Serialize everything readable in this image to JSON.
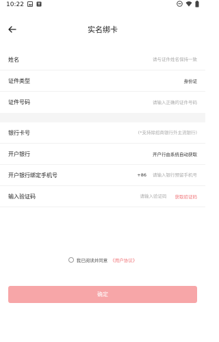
{
  "status_bar": {
    "time": "10:22"
  },
  "header": {
    "title": "实名绑卡"
  },
  "form": {
    "name": {
      "label": "姓名",
      "placeholder": "请与证件姓名保持一致"
    },
    "id_type": {
      "label": "证件类型",
      "value": "身份证"
    },
    "id_number": {
      "label": "证件号码",
      "placeholder": "请输入正确的证件号码"
    },
    "bank_card": {
      "label": "银行卡号",
      "placeholder": "(*支持除招商银行外主流银行)"
    },
    "bank": {
      "label": "开户银行",
      "value": "开户行由系统自动获取"
    },
    "phone": {
      "label": "开户银行绑定手机号",
      "prefix": "+86",
      "placeholder": "请输入银行预留手机号"
    },
    "code": {
      "label": "输入验证码",
      "placeholder": "请输入验证码",
      "action": "获取验证码"
    }
  },
  "agreement": {
    "text": "我已阅读并同意",
    "link": "《用户协议》"
  },
  "confirm_button": {
    "label": "确定"
  },
  "colors": {
    "accent": "#f0767a",
    "button_bg": "#f7a6a8"
  }
}
